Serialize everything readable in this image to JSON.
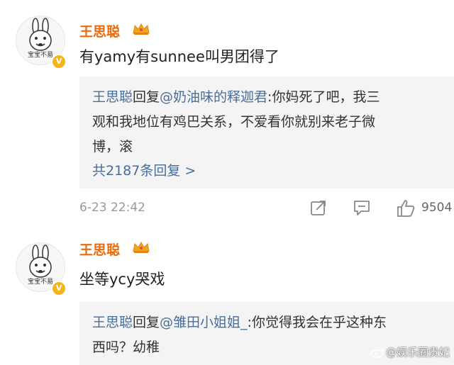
{
  "comments": [
    {
      "avatar_caption": "宝宝不易",
      "username": "王思聪",
      "text": "有yamy有sunnee叫男团得了",
      "reply": {
        "replier": "王思聪",
        "reply_word": "回复",
        "target": "@奶油味的释迦君",
        "line1_rest": ":你妈死了吧，我三",
        "line2": "观和我地位有鸡巴关系，不爱看你就别来老子微",
        "line3": "博，滚"
      },
      "reply_count": "共2187条回复 >",
      "timestamp": "6-23 22:42",
      "likes": "9504"
    },
    {
      "avatar_caption": "宝宝不易",
      "username": "王思聪",
      "text": "坐等ycy哭戏",
      "reply": {
        "replier": "王思聪",
        "reply_word": "回复",
        "target": "@雏田小姐姐_",
        "line1_rest": ":你觉得我会在乎这种东",
        "line2": "西吗？幼稚"
      }
    }
  ],
  "watermark": "@娱乐圈贵妃",
  "icons": {
    "verified": "verified-v-badge-icon",
    "crown": "crown-icon",
    "share": "share-icon",
    "comment": "comment-icon",
    "like": "thumbs-up-icon",
    "weibo": "weibo-logo-icon"
  },
  "colors": {
    "username": "#e86b0f",
    "link": "#4a6d9a",
    "reply_bg": "#f4f4f4",
    "meta": "#999999",
    "verified": "#f6b418"
  }
}
